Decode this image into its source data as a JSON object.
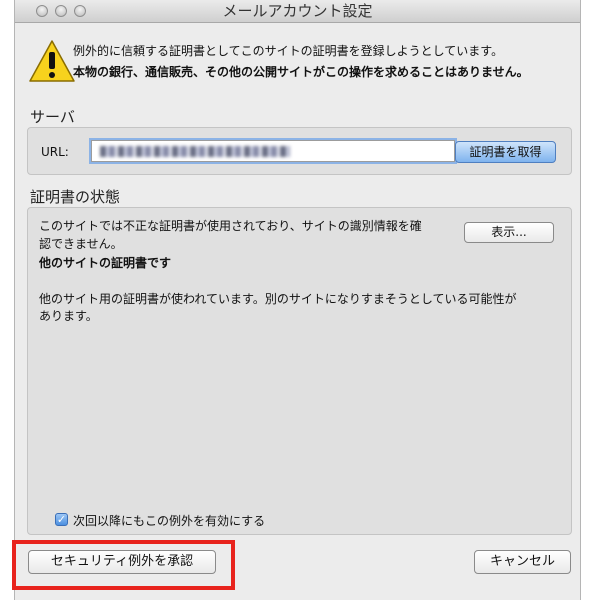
{
  "window": {
    "title": "メールアカウント設定"
  },
  "warning": {
    "icon": "warning-triangle-icon",
    "line1": "例外的に信頼する証明書としてこのサイトの証明書を登録しようとしています。",
    "line2": "本物の銀行、通信販売、その他の公開サイトがこの操作を求めることはありません。"
  },
  "server": {
    "heading": "サーバ",
    "url_label": "URL:",
    "url_value": "",
    "get_cert_button": "証明書を取得"
  },
  "cert_status": {
    "heading": "証明書の状態",
    "line1": "このサイトでは不正な証明書が使用されており、サイトの識別情報を確",
    "line2": "認できません。",
    "view_button": "表示...",
    "subheading": "他のサイトの証明書です",
    "detail_line1": "他のサイト用の証明書が使われています。別のサイトになりすまそうとしている可能性が",
    "detail_line2": "あります。"
  },
  "options": {
    "permanent_label": "次回以降にもこの例外を有効にする",
    "permanent_checked": true
  },
  "footer": {
    "confirm_button": "セキュリティ例外を承認",
    "cancel_button": "キャンセル"
  },
  "colors": {
    "highlight": "#e8231d",
    "warning_yellow": "#f7d21d"
  }
}
